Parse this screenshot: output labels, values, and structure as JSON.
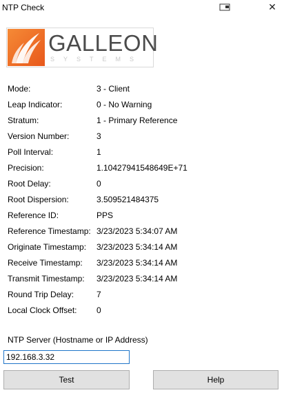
{
  "window": {
    "title": "NTP Check",
    "close_glyph": "✕"
  },
  "logo": {
    "name": "GALLEON",
    "subtitle": "SYSTEMS"
  },
  "info": [
    {
      "label": "Mode:",
      "value": "3 - Client"
    },
    {
      "label": "Leap Indicator:",
      "value": "0 - No Warning"
    },
    {
      "label": "Stratum:",
      "value": "1 - Primary Reference"
    },
    {
      "label": "Version Number:",
      "value": "3"
    },
    {
      "label": "Poll Interval:",
      "value": "1"
    },
    {
      "label": "Precision:",
      "value": "1.10427941548649E+71"
    },
    {
      "label": "Root Delay:",
      "value": "0"
    },
    {
      "label": "Root Dispersion:",
      "value": "3.509521484375"
    },
    {
      "label": "Reference ID:",
      "value": "PPS"
    },
    {
      "label": "Reference Timestamp:",
      "value": "3/23/2023 5:34:07 AM"
    },
    {
      "label": "Originate Timestamp:",
      "value": "3/23/2023 5:34:14 AM"
    },
    {
      "label": "Receive Timestamp:",
      "value": "3/23/2023 5:34:14 AM"
    },
    {
      "label": "Transmit Timestamp:",
      "value": "3/23/2023 5:34:14 AM"
    },
    {
      "label": "Round Trip Delay:",
      "value": "7"
    },
    {
      "label": "Local Clock Offset:",
      "value": "0"
    }
  ],
  "server": {
    "label": "NTP Server (Hostname or IP Address)",
    "value": "192.168.3.32"
  },
  "buttons": {
    "test": "Test",
    "help": "Help"
  },
  "colors": {
    "brand_orange": "#f07a2c",
    "input_focus_border": "#1e74c8",
    "button_face": "#e1e1e1"
  }
}
